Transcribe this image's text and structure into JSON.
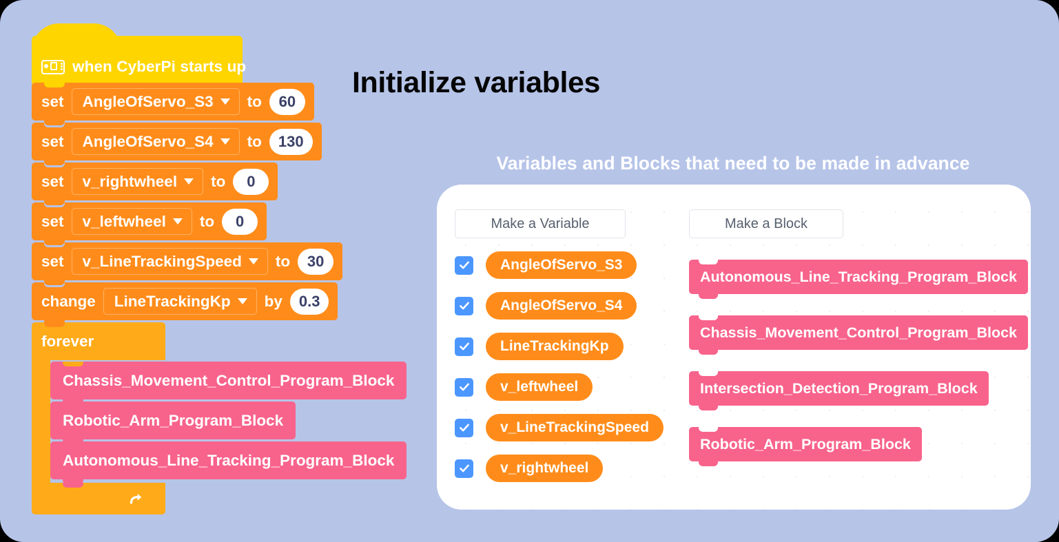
{
  "page": {
    "background_color": "#b6c4e8",
    "title": "Initialize variables"
  },
  "script": {
    "hat": {
      "icon": "cyberpi-device-icon",
      "label": "when CyberPi starts up",
      "color": "#ffd500"
    },
    "statements": [
      {
        "keyword": "set",
        "variable": "AngleOfServo_S3",
        "connector": "to",
        "value": "60"
      },
      {
        "keyword": "set",
        "variable": "AngleOfServo_S4",
        "connector": "to",
        "value": "130"
      },
      {
        "keyword": "set",
        "variable": "v_rightwheel",
        "connector": "to",
        "value": "0"
      },
      {
        "keyword": "set",
        "variable": "v_leftwheel",
        "connector": "to",
        "value": "0"
      },
      {
        "keyword": "set",
        "variable": "v_LineTrackingSpeed",
        "connector": "to",
        "value": "30"
      },
      {
        "keyword": "change",
        "variable": "LineTrackingKp",
        "connector": "by",
        "value": "0.3"
      }
    ],
    "loop": {
      "label": "forever",
      "color": "#ffab19",
      "icon": "loop-arrow-icon",
      "body": [
        {
          "label": "Chassis_Movement_Control_Program_Block"
        },
        {
          "label": "Robotic_Arm_Program_Block"
        },
        {
          "label": "Autonomous_Line_Tracking_Program_Block"
        }
      ]
    },
    "colors": {
      "set_block": "#ff8c1a",
      "custom_block": "#f8638b"
    }
  },
  "card": {
    "heading": "Variables and Blocks that need to be made in advance",
    "heading_color": "#ffffff",
    "variables_column": {
      "button_label": "Make a Variable",
      "items": [
        {
          "label": "AngleOfServo_S3",
          "checked": true
        },
        {
          "label": "AngleOfServo_S4",
          "checked": true
        },
        {
          "label": "LineTrackingKp",
          "checked": true
        },
        {
          "label": "v_leftwheel",
          "checked": true
        },
        {
          "label": "v_LineTrackingSpeed",
          "checked": true
        },
        {
          "label": "v_rightwheel",
          "checked": true
        }
      ],
      "checkbox_color": "#4c97ff",
      "pill_color": "#ff8c1a"
    },
    "blocks_column": {
      "button_label": "Make a Block",
      "items": [
        {
          "label": "Autonomous_Line_Tracking_Program_Block"
        },
        {
          "label": "Chassis_Movement_Control_Program_Block"
        },
        {
          "label": "Intersection_Detection_Program_Block"
        },
        {
          "label": "Robotic_Arm_Program_Block"
        }
      ],
      "block_color": "#f8638b"
    }
  }
}
